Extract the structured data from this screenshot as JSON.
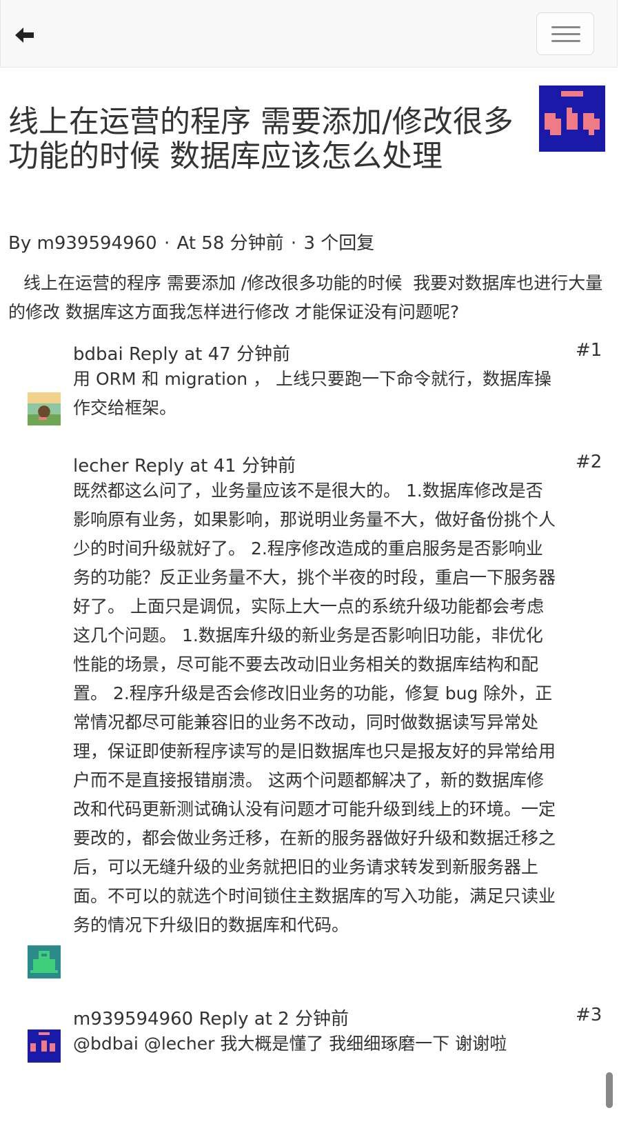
{
  "topic": {
    "title": "线上在运营的程序 需要添加/修改很多功能的时候 数据库应该怎么处理",
    "author": "m939594960",
    "meta_by": "By",
    "meta_time": "At 58 分钟前",
    "meta_replies": "3 个回复",
    "separator": "·",
    "body": "线上在运营的程序 需要添加 /修改很多功能的时候  我要对数据库也进行大量的修改 数据库这方面我怎样进行修改 才能保证没有问题呢?"
  },
  "replies": [
    {
      "author": "bdbai",
      "time": "Reply at 47 分钟前",
      "number": "#1",
      "content": "用 ORM 和 migration ， 上线只要跑一下命令就行，数据库操作交给框架。"
    },
    {
      "author": "lecher",
      "time": "Reply at 41 分钟前",
      "number": "#2",
      "content": "既然都这么问了，业务量应该不是很大的。 1.数据库修改是否影响原有业务，如果影响，那说明业务量不大，做好备份挑个人少的时间升级就好了。 2.程序修改造成的重启服务是否影响业务的功能？反正业务量不大，挑个半夜的时段，重启一下服务器好了。  上面只是调侃，实际上大一点的系统升级功能都会考虑这几个问题。 1.数据库升级的新业务是否影响旧功能，非优化性能的场景，尽可能不要去改动旧业务相关的数据库结构和配置。 2.程序升级是否会修改旧业务的功能，修复 bug 除外，正常情况都尽可能兼容旧的业务不改动，同时做数据读写异常处理，保证即使新程序读写的是旧数据库也只是报友好的异常给用户而不是直接报错崩溃。 这两个问题都解决了，新的数据库修改和代码更新测试确认没有问题才可能升级到线上的环境。一定要改的，都会做业务迁移，在新的服务器做好升级和数据迁移之后，可以无缝升级的业务就把旧的业务请求转发到新服务器上面。不可以的就选个时间锁住主数据库的写入功能，满足只读业务的情况下升级旧的数据库和代码。"
    },
    {
      "author": "m939594960",
      "time": "Reply at 2 分钟前",
      "number": "#3",
      "content": "@bdbai @lecher 我大概是懂了 我细细琢磨一下 谢谢啦"
    }
  ],
  "icons": {
    "back": "arrow-left-icon",
    "menu": "hamburger-menu-icon"
  },
  "colors": {
    "avatar_blue": "#1a1aa8",
    "avatar_pink": "#f07a86",
    "avatar_teal": "#2b8a8a",
    "avatar_green": "#3fcf7a"
  }
}
